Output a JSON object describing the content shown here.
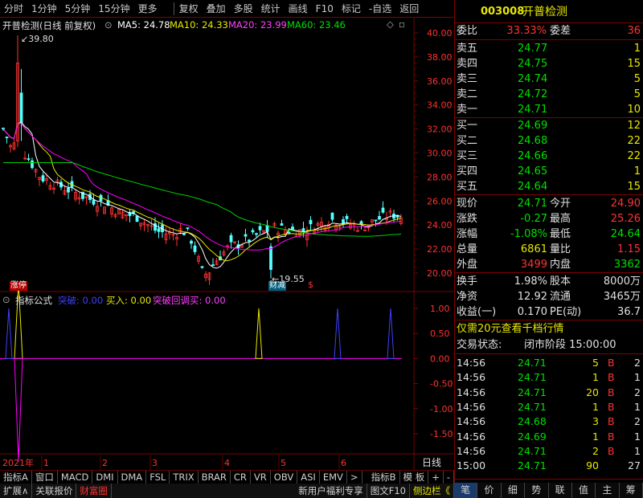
{
  "toolbar": {
    "items": [
      "分时",
      "1分钟",
      "5分钟",
      "15分钟",
      "更多",
      "复权",
      "叠加",
      "多股",
      "统计",
      "画线",
      "F10",
      "标记",
      "-自选",
      "返回"
    ]
  },
  "chart_header": {
    "title": "开普检测(日线 前复权)",
    "ma5": "MA5: 24.78",
    "ma10": "MA10: 24.33",
    "ma20": "MA20: 23.99",
    "ma60": "MA60: 23.46"
  },
  "colors": {
    "ma5": "#ffffff",
    "ma10": "#e8e800",
    "ma20": "#ff00ff",
    "ma60": "#00d000",
    "up": "#ff3232",
    "down": "#54ffff"
  },
  "price_axis": [
    "40.00",
    "38.00",
    "36.00",
    "34.00",
    "32.00",
    "30.00",
    "28.00",
    "26.00",
    "24.00",
    "22.00",
    "20.00"
  ],
  "annotations": {
    "high": "39.80",
    "low": "19.55",
    "badge1": "涨停",
    "badge2": "财减",
    "badge3": "$"
  },
  "indicator_header": {
    "name": "指标公式",
    "s1": "突破: 0.00",
    "s2": "买入: 0.00",
    "s3": "突破回调买: 0.00"
  },
  "indicator_axis": [
    "1.00",
    "0.50",
    "0.00",
    "-0.50",
    "-1.00",
    "-1.50"
  ],
  "time_axis": {
    "year": "2021年",
    "marks": [
      "1",
      "2",
      "3",
      "4",
      "5",
      "6"
    ],
    "label": "日线"
  },
  "bottom_tabs": [
    "指标A",
    "窗口",
    "MACD",
    "DMI",
    "DMA",
    "FSL",
    "TRIX",
    "BRAR",
    "CR",
    "VR",
    "OBV",
    "ASI",
    "EMV",
    ">",
    "指标B",
    "模 板",
    "+",
    "-"
  ],
  "bottom_bar2": {
    "left": [
      "扩展∧",
      "关联报价",
      "财富圈"
    ],
    "right": [
      "新用户福利专享",
      "图文F10",
      "侧边栏《"
    ]
  },
  "right_panel": {
    "code": "003008",
    "name": "开普检测",
    "weibi_label": "委比",
    "weibi": "33.33%",
    "weicha_label": "委差",
    "weicha": "36",
    "asks": [
      {
        "label": "卖五",
        "price": "24.77",
        "vol": "1"
      },
      {
        "label": "卖四",
        "price": "24.75",
        "vol": "15"
      },
      {
        "label": "卖三",
        "price": "24.74",
        "vol": "5"
      },
      {
        "label": "卖二",
        "price": "24.72",
        "vol": "5"
      },
      {
        "label": "卖一",
        "price": "24.71",
        "vol": "10"
      }
    ],
    "bids": [
      {
        "label": "买一",
        "price": "24.69",
        "vol": "12"
      },
      {
        "label": "买二",
        "price": "24.68",
        "vol": "22"
      },
      {
        "label": "买三",
        "price": "24.66",
        "vol": "22"
      },
      {
        "label": "买四",
        "price": "24.65",
        "vol": "1"
      },
      {
        "label": "买五",
        "price": "24.64",
        "vol": "15"
      }
    ],
    "stats": [
      {
        "l1": "现价",
        "v1": "24.71",
        "l2": "今开",
        "v2": "24.90"
      },
      {
        "l1": "涨跌",
        "v1": "-0.27",
        "l2": "最高",
        "v2": "25.26"
      },
      {
        "l1": "涨幅",
        "v1": "-1.08%",
        "l2": "最低",
        "v2": "24.64"
      },
      {
        "l1": "总量",
        "v1": "6861",
        "l2": "量比",
        "v2": "1.15"
      },
      {
        "l1": "外盘",
        "v1": "3499",
        "l2": "内盘",
        "v2": "3362"
      }
    ],
    "stats2": [
      {
        "l1": "换手",
        "v1": "1.98%",
        "l2": "股本",
        "v2": "8000万"
      },
      {
        "l1": "净资",
        "v1": "12.92",
        "l2": "流通",
        "v2": "3465万"
      },
      {
        "l1": "收益(一)",
        "v1": "0.170",
        "l2": "PE(动)",
        "v2": "36.7"
      }
    ],
    "promo": "仅需20元查看千档行情",
    "status_label": "交易状态:",
    "status": "闭市阶段 15:00:00",
    "ticks": [
      {
        "t": "14:56",
        "p": "24.71",
        "v": "5",
        "d": "B",
        "n": "2"
      },
      {
        "t": "14:56",
        "p": "24.71",
        "v": "1",
        "d": "B",
        "n": "1"
      },
      {
        "t": "14:56",
        "p": "24.71",
        "v": "20",
        "d": "B",
        "n": "2"
      },
      {
        "t": "14:56",
        "p": "24.71",
        "v": "1",
        "d": "B",
        "n": "1"
      },
      {
        "t": "14:56",
        "p": "24.68",
        "v": "3",
        "d": "B",
        "n": "2"
      },
      {
        "t": "14:56",
        "p": "24.69",
        "v": "1",
        "d": "B",
        "n": "1"
      },
      {
        "t": "14:56",
        "p": "24.71",
        "v": "2",
        "d": "B",
        "n": "1"
      },
      {
        "t": "15:00",
        "p": "24.71",
        "v": "90",
        "d": "",
        "n": "27"
      }
    ],
    "tabs": [
      "笔",
      "价",
      "细",
      "势",
      "联",
      "值",
      "主",
      "筹"
    ]
  }
}
